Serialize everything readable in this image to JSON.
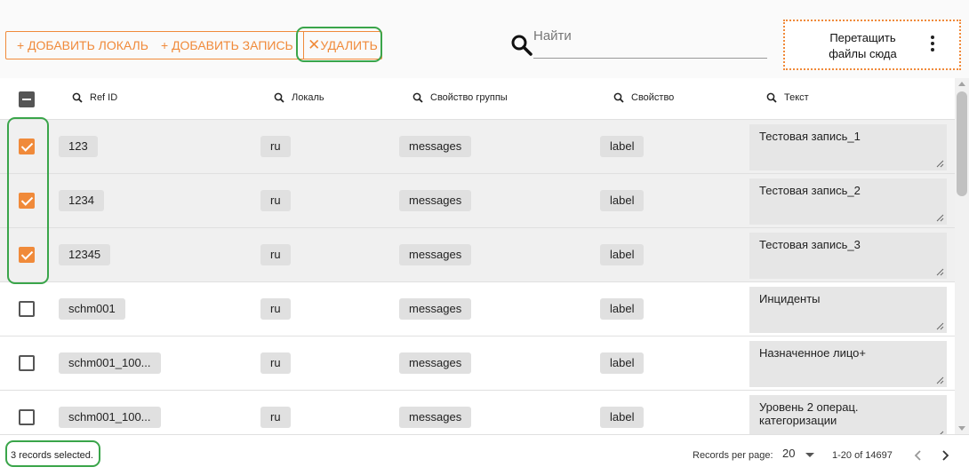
{
  "toolbar": {
    "add_locale_label": "+ ДОБАВИТЬ ЛОКАЛЬ",
    "add_record_label": "+ ДОБАВИТЬ ЗАПИСЬ",
    "delete_mark": "✕",
    "delete_label": "УДАЛИТЬ",
    "search_placeholder": "Найти",
    "dropzone_text": "Перетащить файлы сюда"
  },
  "columns": {
    "ref_id": "Ref ID",
    "locale": "Локаль",
    "group_property": "Свойство группы",
    "property": "Свойство",
    "text": "Текст"
  },
  "rows": [
    {
      "selected": true,
      "ref_id": "123",
      "locale": "ru",
      "group": "messages",
      "property": "label",
      "text": "Тестовая запись_1"
    },
    {
      "selected": true,
      "ref_id": "1234",
      "locale": "ru",
      "group": "messages",
      "property": "label",
      "text": "Тестовая запись_2"
    },
    {
      "selected": true,
      "ref_id": "12345",
      "locale": "ru",
      "group": "messages",
      "property": "label",
      "text": "Тестовая запись_3"
    },
    {
      "selected": false,
      "ref_id": "schm001",
      "locale": "ru",
      "group": "messages",
      "property": "label",
      "text": "Инциденты"
    },
    {
      "selected": false,
      "ref_id": "schm001_100...",
      "locale": "ru",
      "group": "messages",
      "property": "label",
      "text": "Назначенное лицо+"
    },
    {
      "selected": false,
      "ref_id": "schm001_100...",
      "locale": "ru",
      "group": "messages",
      "property": "label",
      "text": "Уровень 2 операц. категоризации"
    }
  ],
  "footer": {
    "selected_text": "3 records selected.",
    "rows_per_page_label": "Records per page:",
    "rows_per_page_value": "20",
    "range_text": "1-20 of 14697"
  },
  "colors": {
    "accent": "#f08a3a",
    "highlight": "#3aa54a",
    "selected_row": "#f0f0f0"
  }
}
